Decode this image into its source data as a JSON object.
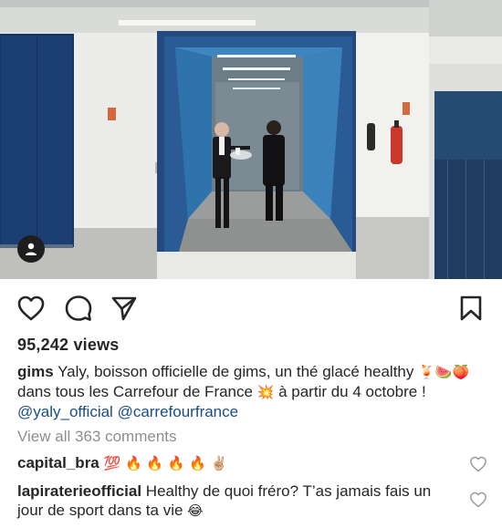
{
  "post": {
    "views": "95,242 views",
    "caption": {
      "username": "gims",
      "text_1": " Yaly, boisson officielle de gims, un thé glacé healthy ",
      "emoji_1": "🍹",
      "emoji_2": "🍉🍑",
      "text_2": " dans tous les Carrefour de France ",
      "emoji_3": "💥",
      "text_3": " à partir du 4 octobre ! ",
      "mention_1": "@yaly_official",
      "mention_2": "@carrefourfrance"
    },
    "view_all_comments": "View all 363 comments"
  },
  "comments": [
    {
      "username": "capital_bra",
      "text": "",
      "emojis": "💯 🔥 🔥 🔥 🔥 ✌🏼"
    },
    {
      "username": "lapiraterieofficial",
      "text": " Healthy de quoi fréro? T’as jamais fais un jour de sport dans ta vie ",
      "emojis": "😂"
    }
  ],
  "icons": {
    "user_tag": "user-tag-icon",
    "like": "heart-icon",
    "comment": "comment-icon",
    "share": "share-icon",
    "save": "bookmark-icon",
    "comment_like": "heart-icon"
  },
  "colors": {
    "text": "#262626",
    "muted": "#8e8e8e",
    "link": "#1a4e86",
    "elevator_blue": "#3a7fb8"
  }
}
